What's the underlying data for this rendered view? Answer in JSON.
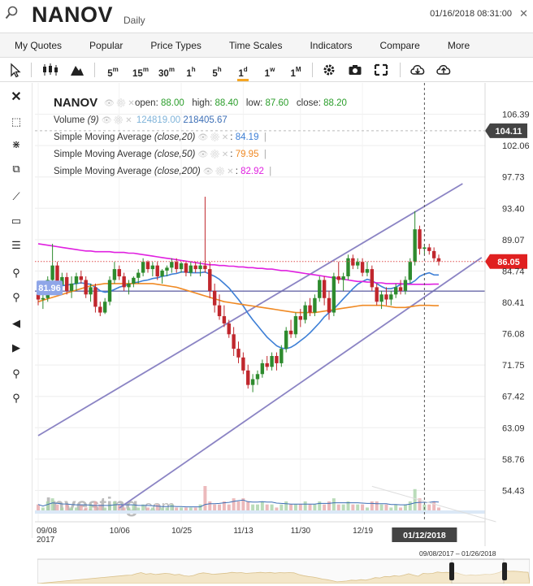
{
  "header": {
    "title": "NANOV",
    "period": "Daily",
    "datetime": "01/16/2018 08:31:00",
    "close_icon": "close-icon",
    "search_icon": "search-icon"
  },
  "menu": [
    "My Quotes",
    "Popular",
    "Price Types",
    "Time Scales",
    "Indicators",
    "Compare",
    "More"
  ],
  "toolbar": {
    "intervals": [
      "5",
      "15",
      "30",
      "1",
      "5",
      "1",
      "1",
      "1"
    ],
    "interval_units": [
      "m",
      "m",
      "m",
      "h",
      "h",
      "d",
      "w",
      "M"
    ],
    "selected_interval": "1d"
  },
  "legend": {
    "symbol": "NANOV",
    "open_label": "open:",
    "open": "88.00",
    "high_label": "high:",
    "high": "88.40",
    "low_label": "low:",
    "low": "87.60",
    "close_label": "close:",
    "close": "88.20",
    "volume_label": "Volume",
    "volume_param": "(9)",
    "volume_value1": "124819.00",
    "volume_value2": "218405.67",
    "sma1_label": "Simple Moving Average",
    "sma1_param": "(close,20)",
    "sma1_value": "84.19",
    "sma2_label": "Simple Moving Average",
    "sma2_param": "(close,50)",
    "sma2_value": "79.95",
    "sma3_label": "Simple Moving Average",
    "sma3_param": "(close,200)",
    "sma3_value": "82.92"
  },
  "colors": {
    "up": "#2e8b2e",
    "down": "#c0272d",
    "sma20": "#3d7fd6",
    "sma50": "#f08a24",
    "sma200": "#e020e0",
    "channel": "#8b84c4",
    "price_tag": "#e02020",
    "crosshair_tag": "#444444",
    "left_tag": "#8fa6e8"
  },
  "chart_data": {
    "type": "candlestick",
    "x_ticks": [
      "09/08\n2017",
      "10/06",
      "10/25",
      "11/13",
      "11/30",
      "12/19"
    ],
    "y_ticks": [
      106.39,
      102.06,
      97.73,
      93.4,
      89.07,
      84.74,
      80.41,
      76.08,
      71.75,
      67.42,
      63.09,
      58.76,
      54.43
    ],
    "ylim": [
      50.1,
      110.72
    ],
    "crosshair_price": "104.11",
    "last_price": "86.05",
    "left_price_tag": "81.96",
    "crosshair_date": "01/12/2018",
    "overview_range": "09/08/2017 – 01/26/2018",
    "candles": [
      [
        81.5,
        82.5,
        80.0,
        80.8
      ],
      [
        80.8,
        81.5,
        79.5,
        81.0
      ],
      [
        81.0,
        84.0,
        80.5,
        83.5
      ],
      [
        83.5,
        88.5,
        82.5,
        85.5
      ],
      [
        85.5,
        86.0,
        82.0,
        82.8
      ],
      [
        82.8,
        84.5,
        82.0,
        83.9
      ],
      [
        83.9,
        84.5,
        81.5,
        82.0
      ],
      [
        82.0,
        84.0,
        81.0,
        83.0
      ],
      [
        83.0,
        84.5,
        82.0,
        84.0
      ],
      [
        84.0,
        84.8,
        83.0,
        83.5
      ],
      [
        83.5,
        84.0,
        81.0,
        81.5
      ],
      [
        81.5,
        83.0,
        80.5,
        82.5
      ],
      [
        82.5,
        83.0,
        79.0,
        79.8
      ],
      [
        79.8,
        80.5,
        78.5,
        79.0
      ],
      [
        79.0,
        81.0,
        78.8,
        80.5
      ],
      [
        80.5,
        84.0,
        80.0,
        83.5
      ],
      [
        83.5,
        86.0,
        83.0,
        85.0
      ],
      [
        85.0,
        85.5,
        83.5,
        84.0
      ],
      [
        84.0,
        84.5,
        82.0,
        82.5
      ],
      [
        82.5,
        83.5,
        81.5,
        83.0
      ],
      [
        83.0,
        84.0,
        82.5,
        83.8
      ],
      [
        83.8,
        85.0,
        83.0,
        84.5
      ],
      [
        84.5,
        86.5,
        84.0,
        86.0
      ],
      [
        86.0,
        86.2,
        84.5,
        85.0
      ],
      [
        85.0,
        86.0,
        84.0,
        85.5
      ],
      [
        85.5,
        86.0,
        83.5,
        84.0
      ],
      [
        84.0,
        85.0,
        83.0,
        84.8
      ],
      [
        84.8,
        85.5,
        84.0,
        85.2
      ],
      [
        85.2,
        86.5,
        84.5,
        86.0
      ],
      [
        86.0,
        86.5,
        84.5,
        85.0
      ],
      [
        85.0,
        86.0,
        84.5,
        85.8
      ],
      [
        85.8,
        86.0,
        84.0,
        84.5
      ],
      [
        84.5,
        86.0,
        84.0,
        85.5
      ],
      [
        85.5,
        86.0,
        84.5,
        85.0
      ],
      [
        85.0,
        86.0,
        84.0,
        85.5
      ],
      [
        85.5,
        95.0,
        84.5,
        85.0
      ],
      [
        85.0,
        86.0,
        81.0,
        82.0
      ],
      [
        82.0,
        83.0,
        79.0,
        80.0
      ],
      [
        80.0,
        81.5,
        78.0,
        78.5
      ],
      [
        78.5,
        80.0,
        77.0,
        77.5
      ],
      [
        77.5,
        78.0,
        75.5,
        76.0
      ],
      [
        76.0,
        77.0,
        73.0,
        74.0
      ],
      [
        74.0,
        75.0,
        72.0,
        72.8
      ],
      [
        72.8,
        73.5,
        70.5,
        71.0
      ],
      [
        71.0,
        71.8,
        68.5,
        69.0
      ],
      [
        69.0,
        70.5,
        68.0,
        69.8
      ],
      [
        69.8,
        71.0,
        69.0,
        70.5
      ],
      [
        70.5,
        72.5,
        70.0,
        72.0
      ],
      [
        72.0,
        73.0,
        71.0,
        71.5
      ],
      [
        71.5,
        73.5,
        71.0,
        73.0
      ],
      [
        73.0,
        73.5,
        71.0,
        72.0
      ],
      [
        72.0,
        74.5,
        71.5,
        74.0
      ],
      [
        74.0,
        77.0,
        73.5,
        76.5
      ],
      [
        76.5,
        78.0,
        75.5,
        76.0
      ],
      [
        76.0,
        79.0,
        75.5,
        78.5
      ],
      [
        78.5,
        79.5,
        77.0,
        78.0
      ],
      [
        78.0,
        80.5,
        77.5,
        80.0
      ],
      [
        80.0,
        81.0,
        78.5,
        79.0
      ],
      [
        79.0,
        81.5,
        78.5,
        81.0
      ],
      [
        81.0,
        84.0,
        80.5,
        83.5
      ],
      [
        83.5,
        84.0,
        80.0,
        81.0
      ],
      [
        81.0,
        82.0,
        78.0,
        79.0
      ],
      [
        79.0,
        84.5,
        78.5,
        84.0
      ],
      [
        84.0,
        86.0,
        83.0,
        83.5
      ],
      [
        83.5,
        84.5,
        82.0,
        84.0
      ],
      [
        84.0,
        87.0,
        83.5,
        86.5
      ],
      [
        86.5,
        87.0,
        85.0,
        85.5
      ],
      [
        85.5,
        86.5,
        85.0,
        86.0
      ],
      [
        86.0,
        86.5,
        84.0,
        84.5
      ],
      [
        84.5,
        86.0,
        84.0,
        85.0
      ],
      [
        85.0,
        85.5,
        82.0,
        82.5
      ],
      [
        82.5,
        83.0,
        80.0,
        80.5
      ],
      [
        80.5,
        82.0,
        79.5,
        81.5
      ],
      [
        81.5,
        82.5,
        80.0,
        80.8
      ],
      [
        80.8,
        82.0,
        80.0,
        81.5
      ],
      [
        81.5,
        83.0,
        81.0,
        82.5
      ],
      [
        82.5,
        83.5,
        81.5,
        82.0
      ],
      [
        82.0,
        84.0,
        81.5,
        83.5
      ],
      [
        83.5,
        86.5,
        83.0,
        86.0
      ],
      [
        86.0,
        93.0,
        85.5,
        90.5
      ],
      [
        90.5,
        91.0,
        87.0,
        87.8
      ],
      [
        87.8,
        88.5,
        87.0,
        88.0
      ],
      [
        88.0,
        88.5,
        87.0,
        87.5
      ],
      [
        87.5,
        88.0,
        86.0,
        86.5
      ],
      [
        86.5,
        87.0,
        85.5,
        86.05
      ]
    ],
    "sma_series": [
      {
        "values": [
          82.0,
          82.0,
          82.1,
          82.3,
          82.5,
          82.7,
          82.8,
          82.9,
          83.0,
          83.1,
          83.0,
          82.9,
          82.5,
          82.0,
          81.8,
          81.9,
          82.2,
          82.5,
          82.7,
          82.9,
          83.1,
          83.2,
          83.4,
          83.5,
          83.7,
          83.8,
          84.0,
          84.1,
          84.3,
          84.4,
          84.6,
          84.6,
          84.5,
          84.5,
          84.5,
          84.6,
          84.3,
          84.0,
          83.6,
          83.0,
          82.4,
          81.6,
          80.8,
          79.9,
          78.9,
          78.0,
          77.2,
          76.4,
          75.6,
          75.0,
          74.4,
          74.1,
          74.0,
          74.2,
          74.6,
          75.1,
          75.6,
          76.2,
          76.9,
          77.6,
          78.4,
          79.0,
          79.5,
          80.2,
          80.9,
          81.6,
          82.3,
          82.9,
          83.3,
          83.6,
          83.4,
          83.0,
          82.6,
          82.3,
          82.3,
          82.5,
          82.9,
          83.0,
          83.0,
          83.4,
          84.0,
          84.3,
          84.5,
          84.2,
          84.19
        ]
      },
      {
        "values": [
          80.5,
          80.7,
          80.9,
          81.1,
          81.3,
          81.5,
          81.7,
          81.9,
          82.1,
          82.3,
          82.5,
          82.7,
          82.8,
          82.9,
          83.0,
          83.0,
          83.0,
          83.0,
          83.0,
          83.0,
          83.0,
          83.0,
          83.0,
          83.0,
          83.0,
          82.9,
          82.8,
          82.7,
          82.6,
          82.5,
          82.3,
          82.1,
          81.9,
          81.7,
          81.5,
          81.3,
          81.1,
          80.9,
          80.7,
          80.5,
          80.4,
          80.3,
          80.2,
          80.1,
          80.0,
          79.9,
          79.8,
          79.7,
          79.6,
          79.5,
          79.4,
          79.3,
          79.2,
          79.1,
          79.0,
          79.0,
          79.0,
          79.0,
          79.0,
          79.1,
          79.2,
          79.3,
          79.4,
          79.5,
          79.6,
          79.7,
          79.8,
          79.9,
          80.0,
          80.0,
          80.0,
          80.0,
          80.0,
          79.9,
          79.8,
          79.7,
          79.7,
          79.7,
          79.8,
          79.9,
          80.0,
          80.0,
          80.0,
          79.95,
          79.95
        ]
      },
      {
        "values": [
          88.5,
          88.4,
          88.3,
          88.2,
          88.1,
          88.0,
          87.9,
          87.8,
          87.7,
          87.6,
          87.5,
          87.5,
          87.4,
          87.4,
          87.4,
          87.4,
          87.3,
          87.3,
          87.3,
          87.2,
          87.2,
          87.1,
          87.0,
          86.9,
          86.8,
          86.7,
          86.6,
          86.5,
          86.4,
          86.3,
          86.2,
          86.1,
          86.0,
          85.9,
          85.8,
          85.7,
          85.6,
          85.6,
          85.5,
          85.5,
          85.4,
          85.4,
          85.3,
          85.3,
          85.2,
          85.2,
          85.1,
          85.1,
          85.0,
          85.0,
          84.9,
          84.8,
          84.8,
          84.7,
          84.6,
          84.5,
          84.4,
          84.3,
          84.2,
          84.1,
          84.0,
          83.9,
          83.8,
          83.7,
          83.6,
          83.5,
          83.4,
          83.3,
          83.3,
          83.2,
          83.2,
          83.1,
          83.1,
          83.0,
          83.0,
          83.0,
          83.0,
          82.9,
          82.9,
          82.9,
          82.9,
          82.9,
          82.9,
          82.92,
          82.92
        ]
      }
    ],
    "volume": [
      3,
      2,
      4,
      5,
      3,
      2,
      3,
      2,
      2,
      3,
      2,
      3,
      4,
      3,
      2,
      3,
      4,
      3,
      2,
      2,
      3,
      2,
      3,
      2,
      2,
      3,
      2,
      2,
      3,
      2,
      2,
      2,
      2,
      2,
      3,
      9,
      4,
      3,
      3,
      4,
      3,
      5,
      4,
      5,
      4,
      3,
      3,
      4,
      3,
      3,
      2,
      3,
      4,
      3,
      3,
      3,
      4,
      3,
      3,
      4,
      3,
      4,
      5,
      3,
      3,
      4,
      3,
      3,
      3,
      2,
      4,
      4,
      3,
      3,
      2,
      3,
      2,
      3,
      4,
      8,
      5,
      3,
      3,
      4,
      2
    ]
  }
}
